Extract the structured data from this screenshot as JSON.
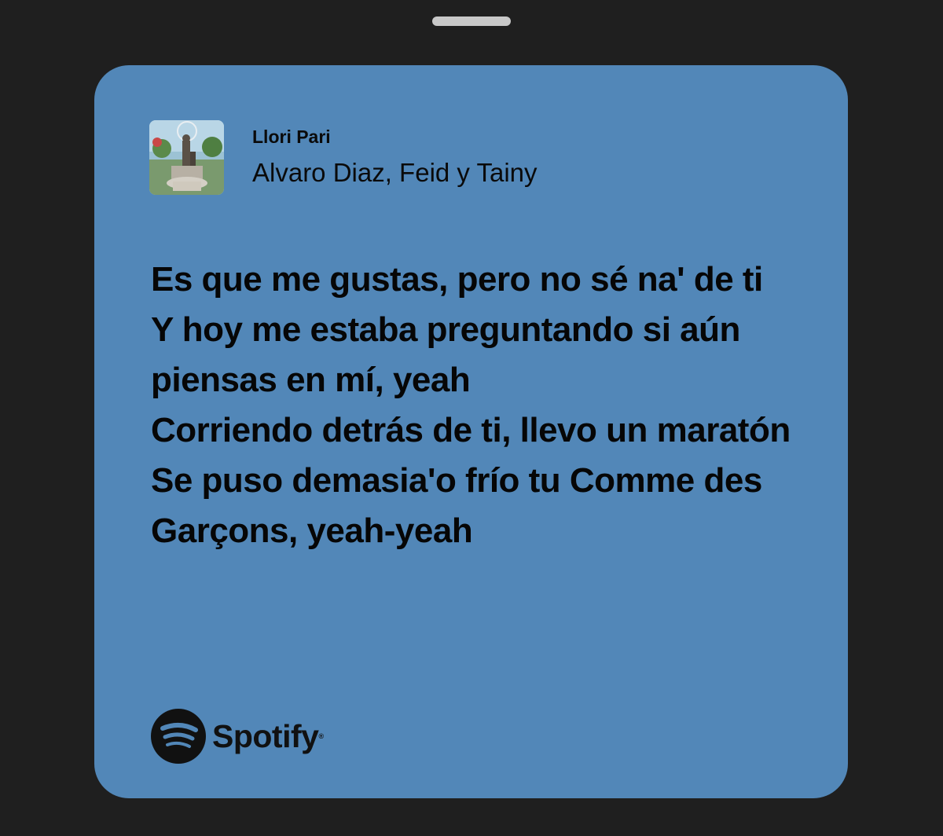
{
  "sheet": {
    "handle_icon": "grabber-handle"
  },
  "card": {
    "background_color": "#5287b8",
    "track": {
      "title": "Llori Pari",
      "artists": "Alvaro Diaz, Feid y Tainy",
      "cover_art_icon": "album-cover-art"
    },
    "lyrics": [
      "Es que me gustas, pero no sé na' de ti",
      "Y hoy me estaba preguntando si aún piensas en mí, yeah",
      "Corriendo detrás de ti, llevo un maratón",
      "Se puso demasia'o frío tu Comme des Garçons, yeah-yeah"
    ],
    "brand": {
      "icon": "spotify-logo-icon",
      "name": "Spotify",
      "trademark": "®"
    }
  }
}
